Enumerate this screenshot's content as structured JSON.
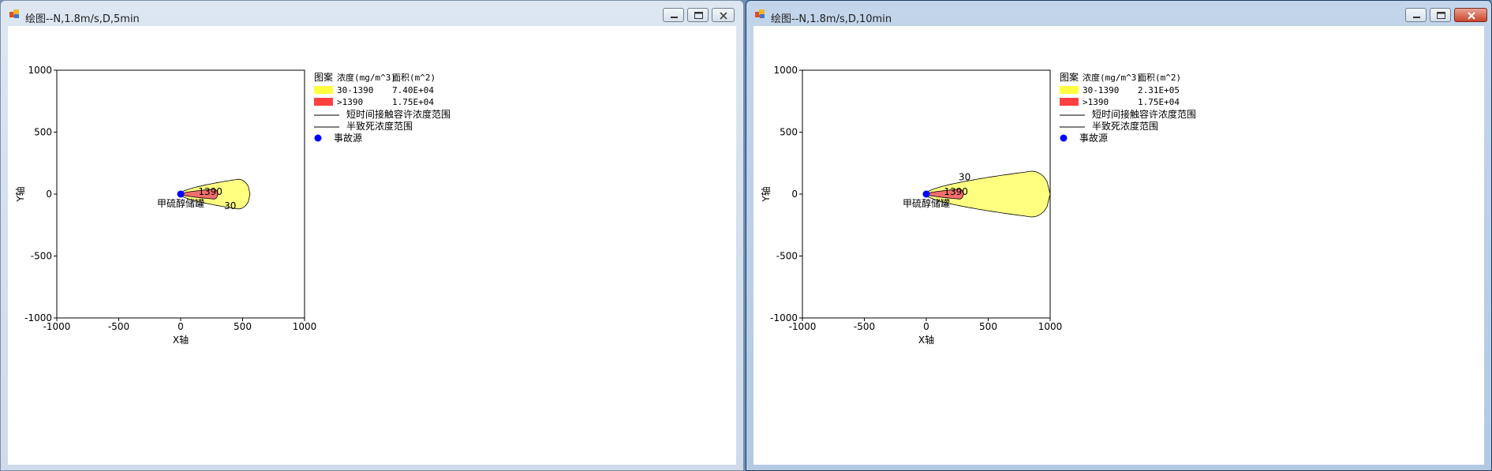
{
  "colors": {
    "zone_low": "#ffff80",
    "zone_high": "#f26d6d",
    "legend_low": "#ffff40",
    "legend_high": "#ff4040",
    "source": "#0000ff"
  },
  "windows": [
    {
      "title": "绘图--N,1.8m/s,D,5min",
      "controls": {
        "minimize": "minimize-icon",
        "maximize": "maximize-icon",
        "close": "close-icon"
      },
      "chart_data": {
        "type": "area",
        "xlabel": "X轴",
        "ylabel": "Y轴",
        "xlim": [
          -1000,
          1000
        ],
        "ylim": [
          -1000,
          1000
        ],
        "xticks": [
          "-1000",
          "-500",
          "0",
          "500",
          "1000"
        ],
        "yticks": [
          "1000",
          "500",
          "0",
          "-500",
          "-1000"
        ],
        "grid": false,
        "legend_position": "right of plot",
        "source_label": "甲硫醇储罐",
        "source_point": [
          0,
          0
        ],
        "contours": [
          {
            "label": "30",
            "max_x": 560,
            "max_half_width": 120
          },
          {
            "label": "1390",
            "max_x": 300,
            "max_half_width": 40
          }
        ],
        "legend": {
          "headers": [
            "图案",
            "浓度(mg/m^3)",
            "面积(m^2)"
          ],
          "rows": [
            {
              "range": "30-1390",
              "area": "7.40E+04"
            },
            {
              "range": ">1390",
              "area": "1.75E+04"
            }
          ],
          "lines": [
            "短时间接触容许浓度范围",
            "半致死浓度范围"
          ],
          "marker": "事故源"
        }
      }
    },
    {
      "title": "绘图--N,1.8m/s,D,10min",
      "controls": {
        "minimize": "minimize-icon",
        "maximize": "maximize-icon",
        "close": "close-icon"
      },
      "chart_data": {
        "type": "area",
        "xlabel": "X轴",
        "ylabel": "Y轴",
        "xlim": [
          -1000,
          1000
        ],
        "ylim": [
          -1000,
          1000
        ],
        "xticks": [
          "-1000",
          "-500",
          "0",
          "500",
          "1000"
        ],
        "yticks": [
          "1000",
          "500",
          "0",
          "-500",
          "-1000"
        ],
        "grid": false,
        "legend_position": "right of plot",
        "source_label": "甲硫醇储罐",
        "source_point": [
          0,
          0
        ],
        "contours": [
          {
            "label": "30",
            "max_x": 1000,
            "max_half_width": 185
          },
          {
            "label": "1390",
            "max_x": 300,
            "max_half_width": 40
          }
        ],
        "legend": {
          "headers": [
            "图案",
            "浓度(mg/m^3)",
            "面积(m^2)"
          ],
          "rows": [
            {
              "range": "30-1390",
              "area": "2.31E+05"
            },
            {
              "range": ">1390",
              "area": "1.75E+04"
            }
          ],
          "lines": [
            "短时间接触容许浓度范围",
            "半致死浓度范围"
          ],
          "marker": "事故源"
        }
      }
    }
  ]
}
